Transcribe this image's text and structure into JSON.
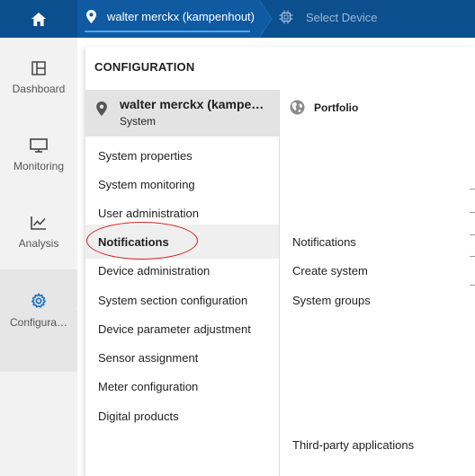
{
  "topbar": {
    "home_icon": "home-icon",
    "system_crumb": {
      "icon": "location-pin-icon",
      "label": "walter merckx (kampenhout)"
    },
    "device_crumb": {
      "icon": "chip-icon",
      "label": "Select Device"
    }
  },
  "sidebar": {
    "items": [
      {
        "label": "Dashboard",
        "icon": "dashboard-icon"
      },
      {
        "label": "Monitoring",
        "icon": "monitor-icon"
      },
      {
        "label": "Analysis",
        "icon": "chart-line-icon"
      },
      {
        "label": "Configura…",
        "icon": "gear-icon",
        "active": true
      }
    ]
  },
  "panel": {
    "title": "CONFIGURATION",
    "system": {
      "name": "walter merckx (kampe…",
      "subtitle": "System"
    },
    "left_items": [
      "System properties",
      "System monitoring",
      "User administration",
      "Notifications",
      "Device administration",
      "System section configuration",
      "Device parameter adjustment",
      "Sensor assignment",
      "Meter configuration",
      "Digital products"
    ],
    "highlighted_item": "Notifications",
    "right_header": {
      "label": "Portfolio",
      "icon": "globe-icon"
    },
    "right_items": [
      "Notifications",
      "Create system",
      "System groups",
      "Third-party applications"
    ]
  },
  "colors": {
    "topbar": "#0b4f8e",
    "active_crumb": "#0f5aa0",
    "accent": "#1a73c8",
    "highlight_circle": "#cc2020"
  }
}
